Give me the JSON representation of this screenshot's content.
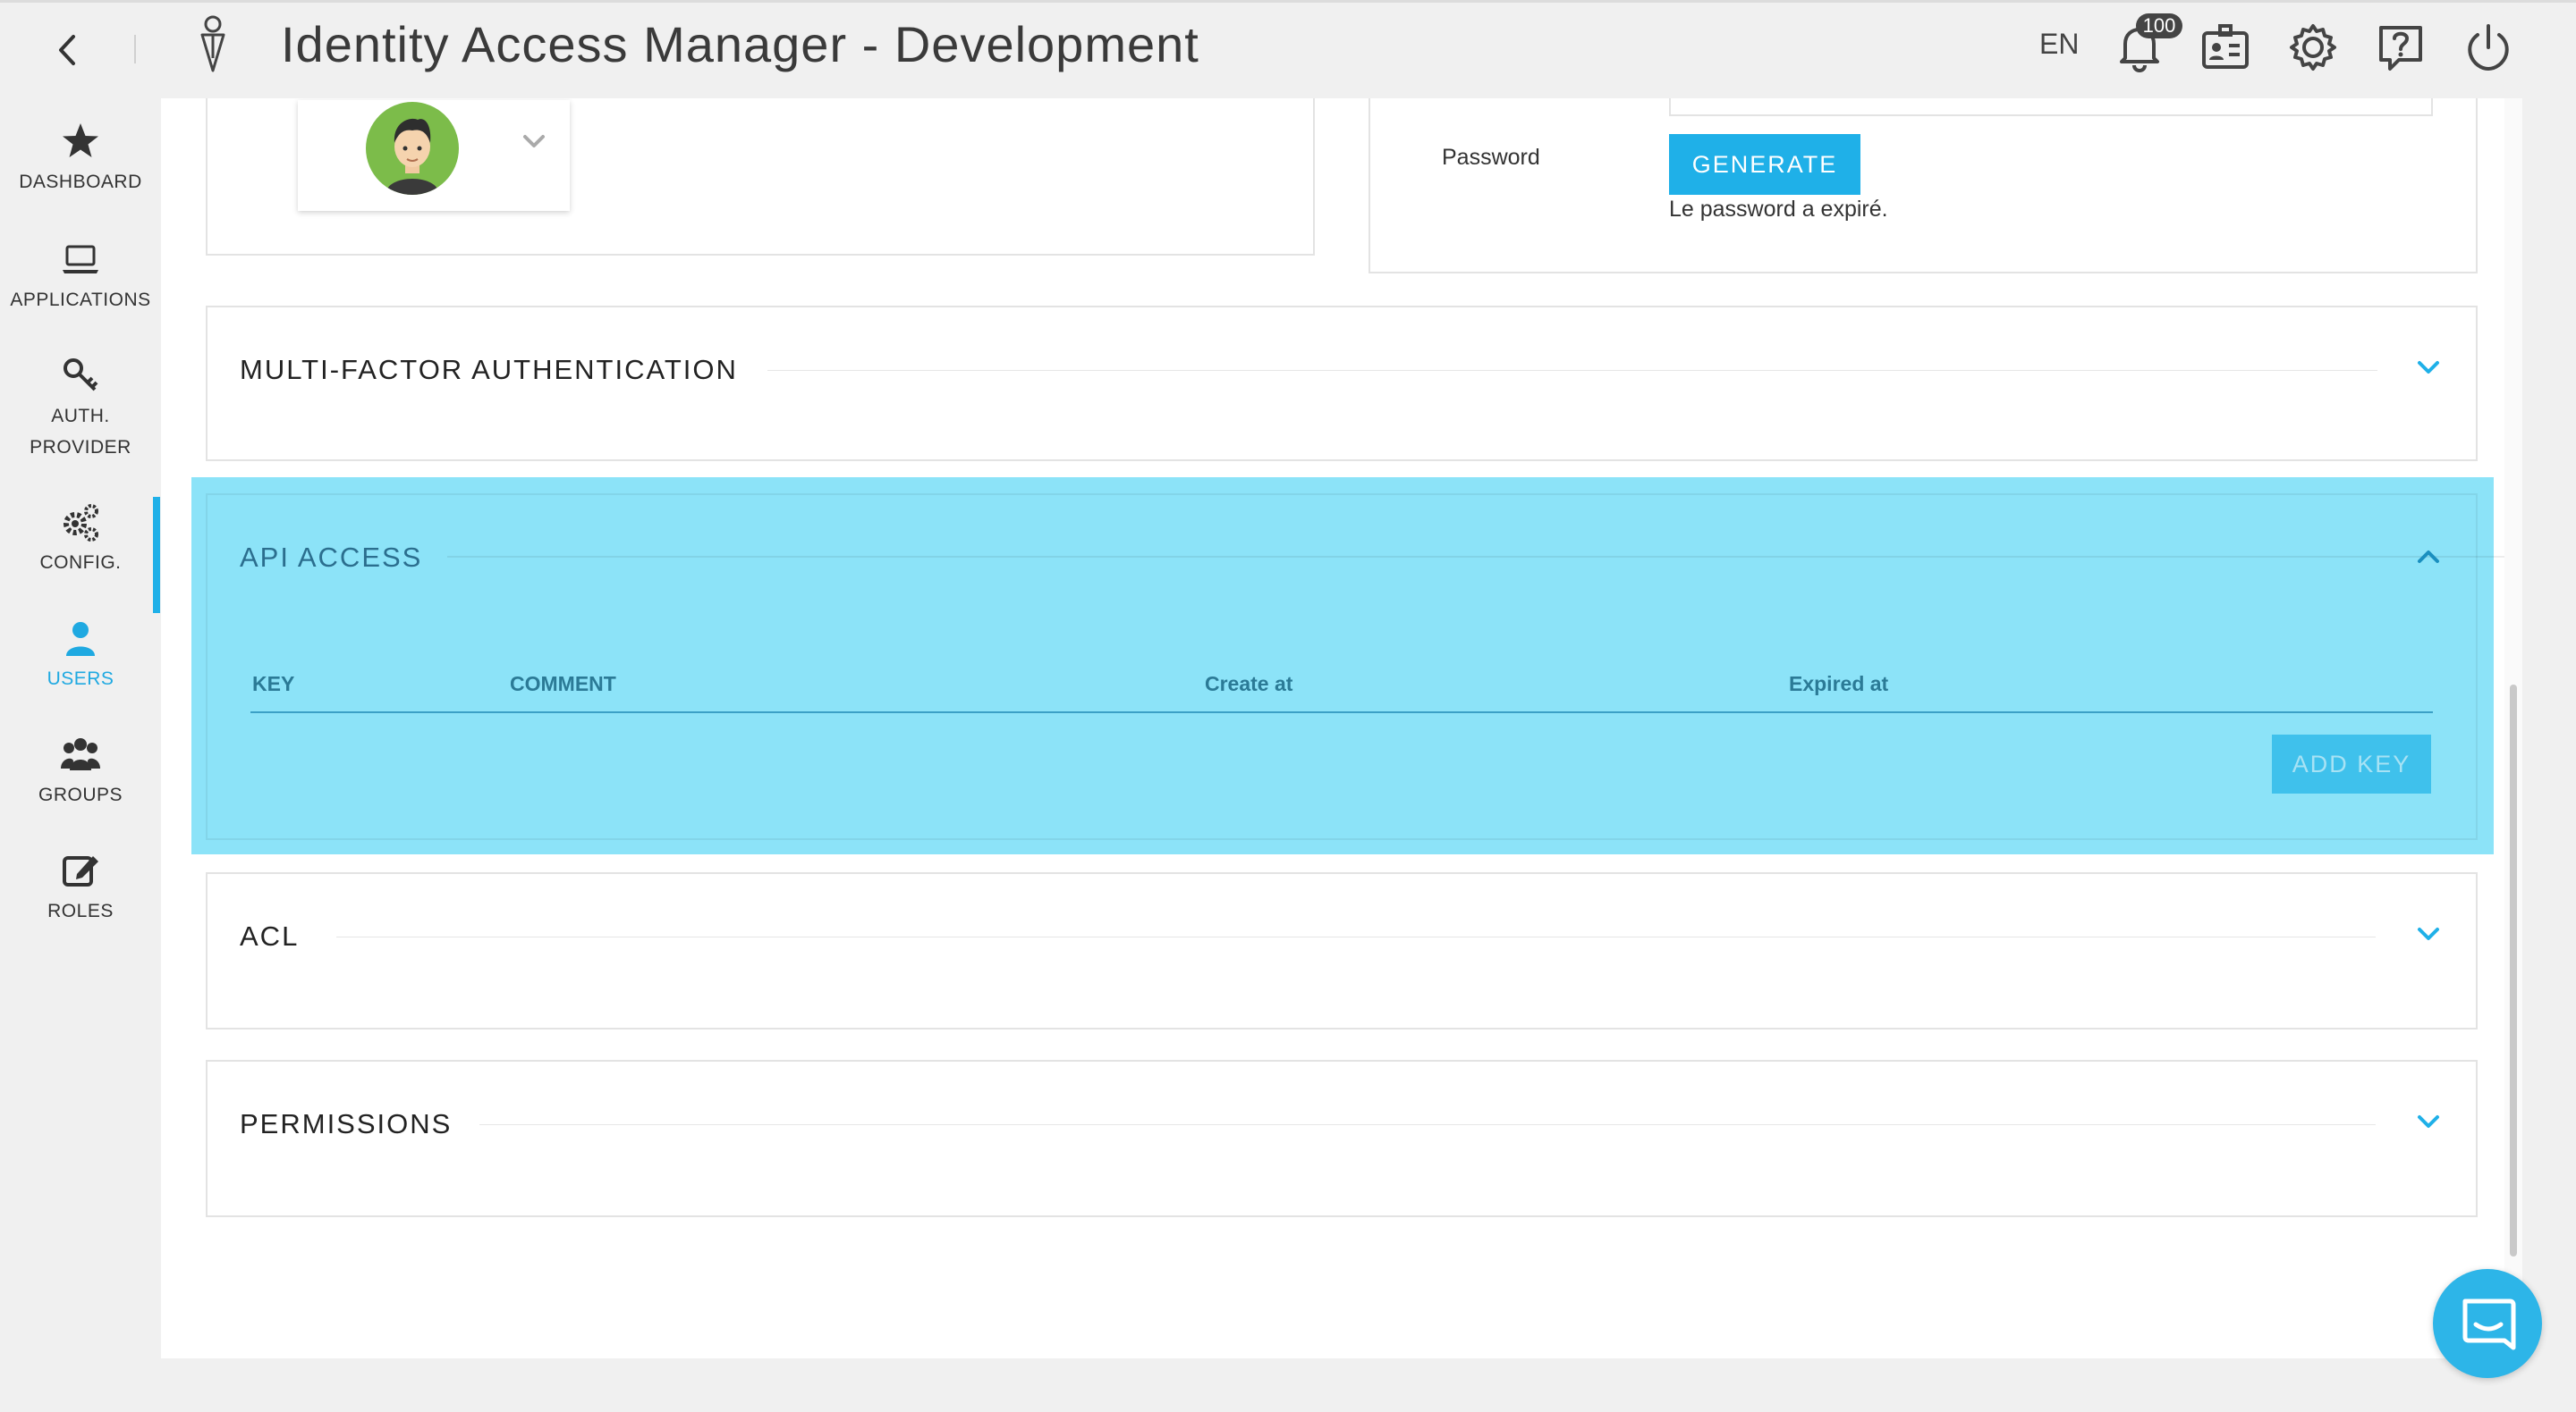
{
  "header": {
    "title": "Identity Access Manager - Development",
    "language": "EN",
    "notification_count": "100",
    "icons": [
      "back-icon",
      "logo-icon",
      "bell-icon",
      "id-card-icon",
      "gear-icon",
      "help-icon",
      "power-icon"
    ]
  },
  "sidebar": {
    "items": [
      {
        "label": "DASHBOARD",
        "icon": "star-icon"
      },
      {
        "label": "APPLICATIONS",
        "icon": "laptop-icon"
      },
      {
        "label_line1": "AUTH.",
        "label_line2": "PROVIDER",
        "icon": "key-icon"
      },
      {
        "label": "CONFIG.",
        "icon": "gears-icon"
      },
      {
        "label": "USERS",
        "icon": "user-icon",
        "active": true
      },
      {
        "label": "GROUPS",
        "icon": "group-icon"
      },
      {
        "label": "ROLES",
        "icon": "edit-icon"
      }
    ]
  },
  "password": {
    "label": "Password",
    "generate_label": "GENERATE",
    "expired_message": "Le password a expiré."
  },
  "sections": {
    "mfa": {
      "title": "MULTI-FACTOR AUTHENTICATION",
      "expanded": false
    },
    "api": {
      "title": "API ACCESS",
      "expanded": true,
      "columns": [
        "KEY",
        "COMMENT",
        "Create at",
        "Expired at"
      ],
      "add_key_label": "ADD KEY"
    },
    "acl": {
      "title": "ACL",
      "expanded": false
    },
    "permissions": {
      "title": "PERMISSIONS",
      "expanded": false
    }
  },
  "colors": {
    "accent": "#1fb0e8",
    "highlight": "#8ce3f8",
    "active_nav": "#1fa9e1"
  }
}
